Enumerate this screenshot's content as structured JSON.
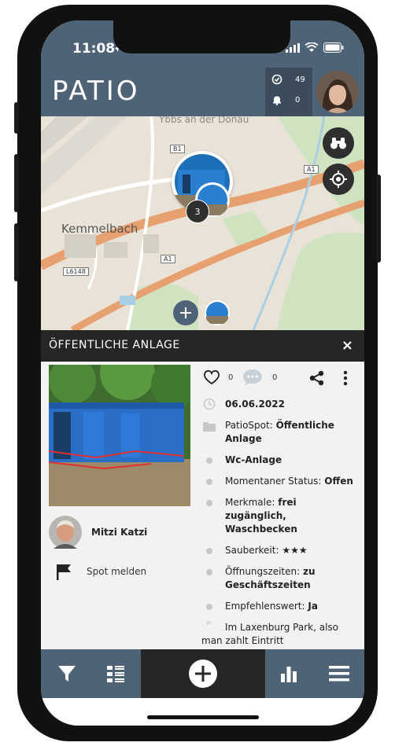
{
  "status_bar": {
    "time": "11:08"
  },
  "header": {
    "logo": "PATIO",
    "counter_checks": "49",
    "counter_notifications": "0"
  },
  "map": {
    "town_label": "Kemmelbach",
    "top_label": "Ybbs an der Donau",
    "road_signs": [
      "B1",
      "A1",
      "A1",
      "L6148"
    ],
    "cluster_count": "3"
  },
  "panel": {
    "title": "ÖFFENTLICHE ANLAGE",
    "close_label": "×"
  },
  "details": {
    "likes": "0",
    "comments": "0",
    "date": "06.06.2022",
    "spot_prefix": "PatioSpot: ",
    "spot_value": "Öffentliche Anlage",
    "type": "Wc-Anlage",
    "status_prefix": "Momentaner Status: ",
    "status_value": "Offen",
    "features_prefix": "Merkmale: ",
    "features_value": "frei zugänglich, Waschbecken",
    "cleanliness_prefix": "Sauberkeit: ",
    "cleanliness_value": "★★★",
    "hours_prefix": "Öffnungszeiten: ",
    "hours_value": "zu Geschäftszeiten",
    "recommend_prefix": "Empfehlenswert: ",
    "recommend_value": "Ja",
    "comment": "Im Laxenburg Park, also man zahlt Eintritt"
  },
  "user": {
    "name": "Mitzi Katzi",
    "report_label": "Spot melden"
  },
  "colors": {
    "header": "#4f6377",
    "header_dark": "#3c4c5d",
    "panel_head": "#262626",
    "content_bg": "#f2f2f2"
  }
}
